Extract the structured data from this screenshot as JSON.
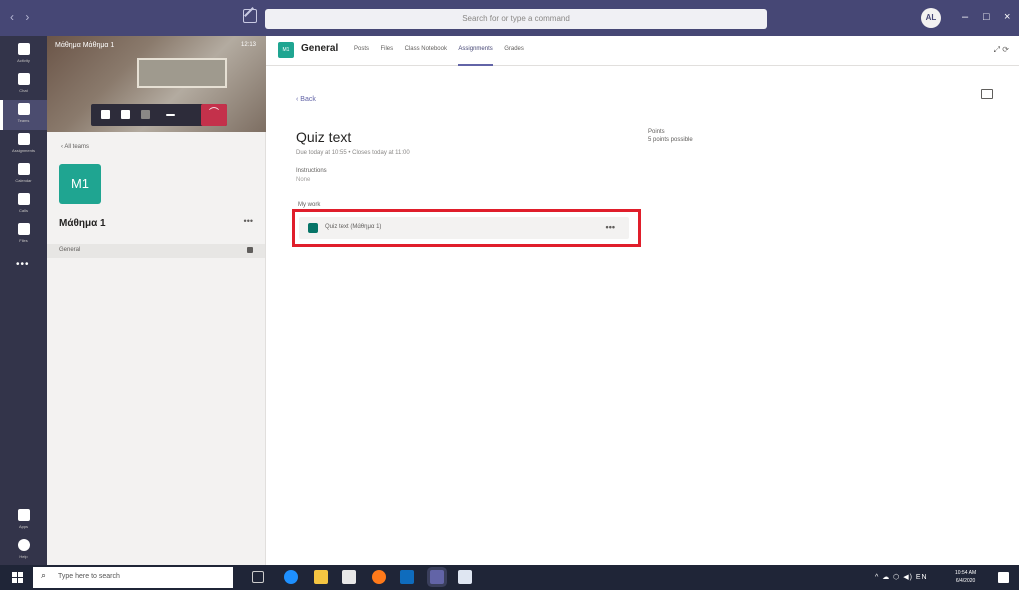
{
  "titlebar": {
    "nav": "‹ ›",
    "search_placeholder": "Search for or type a command",
    "avatar_initials": "AL",
    "minimize": "–",
    "maximize": "□",
    "close": "×"
  },
  "rail": {
    "items": [
      {
        "label": "Activity"
      },
      {
        "label": "Chat"
      },
      {
        "label": "Teams"
      },
      {
        "label": "Assignments"
      },
      {
        "label": "Calendar"
      },
      {
        "label": "Calls"
      },
      {
        "label": "Files"
      }
    ],
    "more": "•••",
    "bottom": [
      {
        "label": "Apps"
      },
      {
        "label": "Help"
      }
    ]
  },
  "call": {
    "name": "Μάθημα Μάθημα 1",
    "time": "12:13"
  },
  "teams_panel": {
    "back": "‹ All teams",
    "team_initials": "M1",
    "team_name": "Μάθημα 1",
    "more": "•••",
    "channel": "General"
  },
  "channel_header": {
    "badge": "M1",
    "title": "General",
    "tabs": [
      "Posts",
      "Files",
      "Class Notebook",
      "Assignments",
      "Grades"
    ],
    "active_tab_index": 3,
    "icons": "⤢  ⟳"
  },
  "assignment": {
    "back": "‹  Back",
    "title": "Quiz text",
    "due": "Due today at 10:55  •  Closes today at 11:00",
    "instructions_label": "Instructions",
    "instructions_value": "None",
    "points_label": "Points",
    "points_value": "5 points possible",
    "my_work_label": "My work",
    "work_item": "Quiz text (Μάθημα 1)",
    "work_more": "•••"
  },
  "taskbar": {
    "search_placeholder": "Type here to search",
    "tray": "^ ☁ ⬡ ◀) EN",
    "time": "10:54 AM",
    "date": "6/4/2020"
  }
}
